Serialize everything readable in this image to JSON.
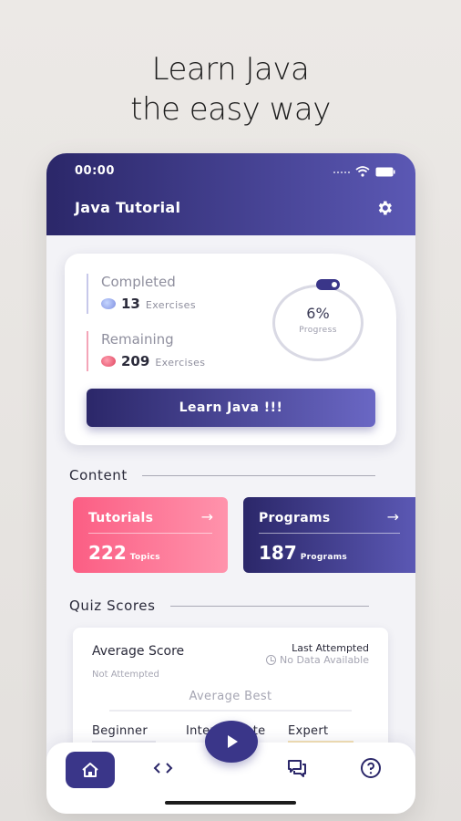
{
  "headline": {
    "line1": "Learn Java",
    "line2": "the easy way"
  },
  "status": {
    "time": "00:00"
  },
  "appbar": {
    "title": "Java Tutorial",
    "settings_icon": "gear-icon"
  },
  "progress": {
    "completed_label": "Completed",
    "completed_count": "13",
    "completed_unit": "Exercises",
    "remaining_label": "Remaining",
    "remaining_count": "209",
    "remaining_unit": "Exercises",
    "percent": "6%",
    "percent_label": "Progress",
    "button": "Learn Java !!!"
  },
  "content": {
    "title": "Content",
    "tutorials": {
      "title": "Tutorials",
      "count": "222",
      "unit": "Topics"
    },
    "programs": {
      "title": "Programs",
      "count": "187",
      "unit": "Programs"
    }
  },
  "quiz": {
    "title": "Quiz Scores",
    "average_score": "Average Score",
    "not_attempted": "Not Attempted",
    "last_attempted": "Last Attempted",
    "no_data": "No Data Available",
    "average_best": "Average Best",
    "levels": [
      "Beginner",
      "Intermediate",
      "Expert"
    ],
    "partial_hidden_text": "er"
  },
  "colors": {
    "primary": "#2b2769",
    "accent": "#5b58b4",
    "pink": "#fb5e84"
  },
  "nav": {
    "items": [
      "home-icon",
      "code-icon",
      "play-icon",
      "chat-icon",
      "help-icon"
    ]
  }
}
